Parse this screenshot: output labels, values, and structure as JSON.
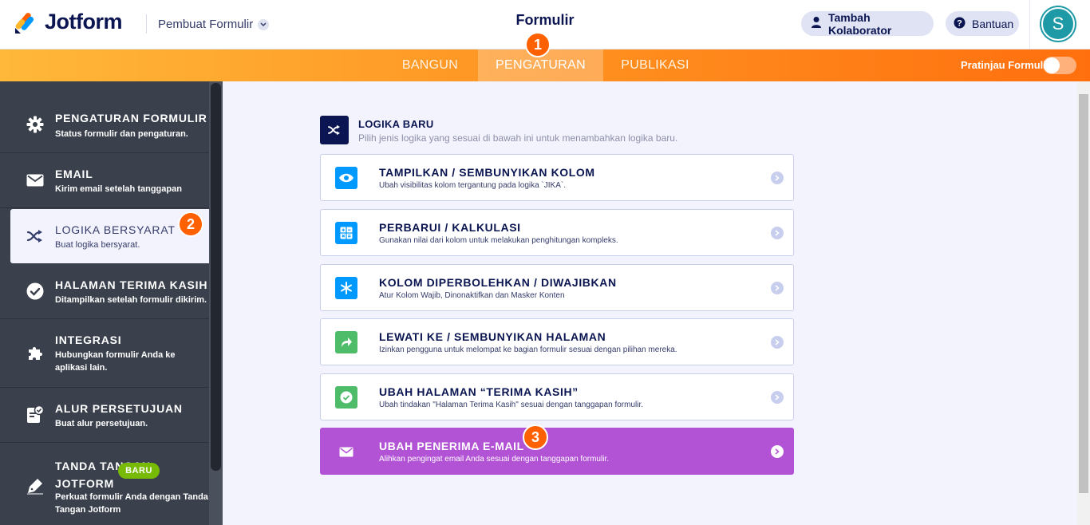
{
  "header": {
    "logo_text": "Jotform",
    "builder_label": "Pembuat Formulir",
    "form_title": "Formulir",
    "collaborator_label": "Tambah Kolaborator",
    "help_label": "Bantuan",
    "avatar_initial": "S"
  },
  "nav": {
    "tabs": [
      {
        "label": "BANGUN"
      },
      {
        "label": "PENGATURAN"
      },
      {
        "label": "PUBLIKASI"
      }
    ],
    "active_tab": "PENGATURAN",
    "preview_label": "Pratinjau Formulir",
    "preview_on": false
  },
  "steps": [
    "1",
    "2",
    "3"
  ],
  "sidebar": {
    "items": [
      {
        "title": "PENGATURAN FORMULIR",
        "desc": "Status formulir dan pengaturan.",
        "icon": "gear-icon"
      },
      {
        "title": "EMAIL",
        "desc": "Kirim email setelah tanggapan",
        "icon": "envelope-icon"
      },
      {
        "title": "LOGIKA BERSYARAT",
        "desc": "Buat logika bersyarat.",
        "icon": "shuffle-icon"
      },
      {
        "title": "HALAMAN TERIMA KASIH",
        "desc": "Ditampilkan setelah formulir dikirim.",
        "icon": "check-circle-icon"
      },
      {
        "title": "INTEGRASI",
        "desc": "Hubungkan formulir Anda ke aplikasi lain.",
        "icon": "puzzle-icon"
      },
      {
        "title": "ALUR PERSETUJUAN",
        "desc": "Buat alur persetujuan.",
        "icon": "approval-icon"
      },
      {
        "title": "TANDA TANGAN JOTFORM",
        "desc": "Perkuat formulir Anda dengan Tanda Tangan Jotform",
        "icon": "pen-icon",
        "badge": "BARU"
      }
    ],
    "active_index": 2
  },
  "main": {
    "section_title": "LOGIKA BARU",
    "section_sub": "Pilih jenis logika yang sesuai di bawah ini untuk menambahkan logika baru.",
    "cards": [
      {
        "title": "TAMPILKAN / SEMBUNYIKAN KOLOM",
        "desc": "Ubah visibilitas kolom tergantung pada logika `JIKA`.",
        "icon": "eye-icon",
        "color": "#0099ff"
      },
      {
        "title": "PERBARUI / KALKULASI",
        "desc": "Gunakan nilai dari kolom untuk melakukan penghitungan kompleks.",
        "icon": "calculator-icon",
        "color": "#0099ff"
      },
      {
        "title": "KOLOM DIPERBOLEHKAN / DIWAJIBKAN",
        "desc": "Atur Kolom Wajib, Dinonaktifkan dan Masker Konten",
        "icon": "asterisk-icon",
        "color": "#0099ff"
      },
      {
        "title": "LEWATI KE / SEMBUNYIKAN HALAMAN",
        "desc": "Izinkan pengguna untuk melompat ke bagian formulir sesuai dengan pilihan mereka.",
        "icon": "redirect-arrow-icon",
        "color": "#4fbc6a"
      },
      {
        "title": "UBAH HALAMAN “TERIMA KASIH”",
        "desc": "Ubah tindakan \"Halaman Terima Kasih\" sesuai dengan tanggapan formulir.",
        "icon": "check-icon",
        "color": "#4fbc6a"
      },
      {
        "title": "UBAH PENERIMA E-MAIL",
        "desc": "Alihkan pengingat email Anda sesuai dengan tanggapan formulir.",
        "icon": "envelope-icon",
        "color": "#b252d4"
      }
    ]
  }
}
